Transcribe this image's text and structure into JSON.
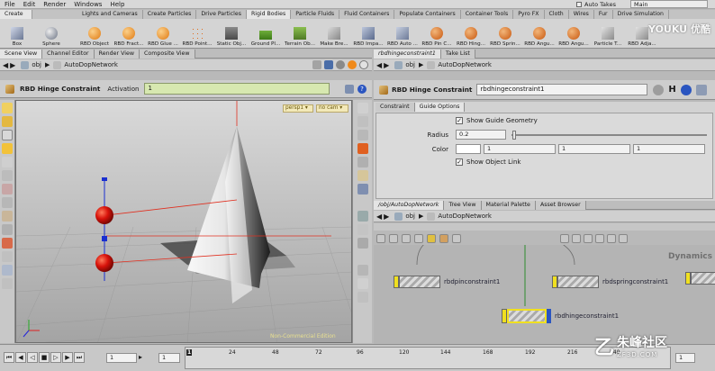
{
  "menu": [
    "File",
    "Edit",
    "Render",
    "Windows",
    "Help"
  ],
  "autotakes_label": "Auto Takes",
  "desktop": "Main",
  "shelf_tabs": [
    "Create",
    "Lights and Cameras",
    "Create Particles",
    "Drive Particles",
    "Rigid Bodies",
    "Particle Fluids",
    "Fluid Containers",
    "Populate Containers",
    "Container Tools",
    "Pyro FX",
    "Cloth",
    "Wires",
    "Fur",
    "Drive Simulation"
  ],
  "shelf_active": "Rigid Bodies",
  "create_tools": [
    "Box",
    "Sphere"
  ],
  "rbd_tools": [
    "RBD Object",
    "RBD Fract...",
    "RBD Glue ...",
    "RBD Point...",
    "Static Obj...",
    "Ground Pl...",
    "Terrain Ob...",
    "Make Bre...",
    "RBD Impa...",
    "RBD Auto ...",
    "RBD Pin C...",
    "RBD Hing...",
    "RBD Sprin...",
    "RBD Angu...",
    "RBD Angu...",
    "Particle T...",
    "RBD Adja..."
  ],
  "left_tabs": [
    "Scene View",
    "Channel Editor",
    "Render View",
    "Composite View"
  ],
  "left_path": {
    "obj": "obj",
    "network": "AutoDopNetwork"
  },
  "tool_bar": {
    "title": "RBD Hinge Constraint",
    "activation_label": "Activation",
    "activation_value": "1"
  },
  "viewport": {
    "camera": "persp1 ▾",
    "cam": "no cam ▾",
    "watermark": "Non-Commercial Edition"
  },
  "right_tabs_top": [
    "rbdhingeconstraint1",
    "Take List"
  ],
  "right_path_top": {
    "obj": "obj",
    "network": "AutoDopNetwork"
  },
  "node_header": {
    "type": "RBD Hinge Constraint",
    "name": "rbdhingeconstraint1",
    "h_label": "H"
  },
  "param_tabs": [
    "Constraint",
    "Guide Options"
  ],
  "params": {
    "show_guide": "Show Guide Geometry",
    "radius_label": "Radius",
    "radius_value": "0.2",
    "color_label": "Color",
    "color_values": [
      "1",
      "1",
      "1"
    ],
    "show_link": "Show Object Link"
  },
  "net_tabs": [
    "/obj/AutoDopNetwork",
    "Tree View",
    "Material Palette",
    "Asset Browser"
  ],
  "net_path": {
    "obj": "obj",
    "network": "AutoDopNetwork"
  },
  "net_context": "Dynamics",
  "nodes": [
    "rbdpinconstraint1",
    "rbdspringconstraint1",
    "rbdhingeconstraint1"
  ],
  "timeline": {
    "frame": "1",
    "start": "1",
    "end": "1",
    "ticks": [
      "24",
      "48",
      "72",
      "96",
      "120",
      "144",
      "168",
      "192",
      "216",
      "240"
    ],
    "current_marker": "1"
  },
  "overlay": {
    "youku": "YOUKU 优酷",
    "logo": "朱峰社区",
    "site": "ZF3D.COM"
  },
  "colors": {
    "accent_orange": "#f08a1a",
    "sphere_red": "#d8130b",
    "activation_bg": "#d7e8b0",
    "node_yellow": "#f0e020",
    "node_blue": "#2a55c0"
  }
}
